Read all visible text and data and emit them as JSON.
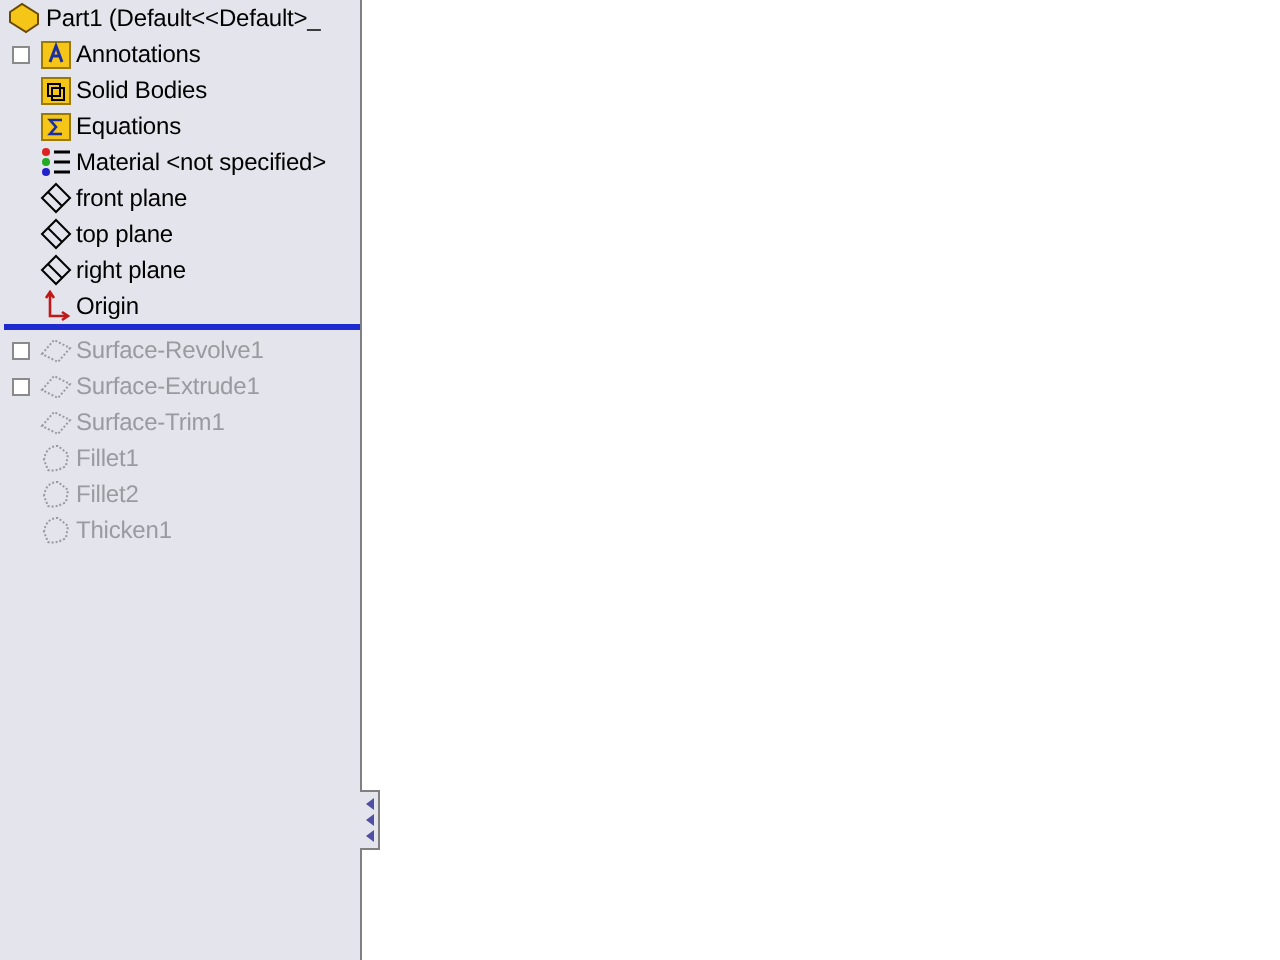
{
  "tree": {
    "root": {
      "label": "Part1  (Default<<Default>_"
    },
    "items": [
      {
        "label": "Annotations",
        "kind": "annotations",
        "expandable": true,
        "rolled_back": false
      },
      {
        "label": "Solid Bodies",
        "kind": "bodies",
        "expandable": false,
        "rolled_back": false
      },
      {
        "label": "Equations",
        "kind": "equations",
        "expandable": false,
        "rolled_back": false
      },
      {
        "label": "Material <not specified>",
        "kind": "material",
        "expandable": false,
        "rolled_back": false
      },
      {
        "label": "front plane",
        "kind": "plane",
        "expandable": false,
        "rolled_back": false
      },
      {
        "label": "top plane",
        "kind": "plane",
        "expandable": false,
        "rolled_back": false
      },
      {
        "label": "right plane",
        "kind": "plane",
        "expandable": false,
        "rolled_back": false
      },
      {
        "label": "Origin",
        "kind": "origin",
        "expandable": false,
        "rolled_back": false
      },
      {
        "kind": "rollback"
      },
      {
        "label": "Surface-Revolve1",
        "kind": "surface",
        "expandable": true,
        "rolled_back": true
      },
      {
        "label": "Surface-Extrude1",
        "kind": "surface",
        "expandable": true,
        "rolled_back": true
      },
      {
        "label": "Surface-Trim1",
        "kind": "surface",
        "expandable": false,
        "rolled_back": true
      },
      {
        "label": "Fillet1",
        "kind": "fillet",
        "expandable": false,
        "rolled_back": true
      },
      {
        "label": "Fillet2",
        "kind": "fillet",
        "expandable": false,
        "rolled_back": true
      },
      {
        "label": "Thicken1",
        "kind": "fillet",
        "expandable": false,
        "rolled_back": true
      }
    ]
  }
}
